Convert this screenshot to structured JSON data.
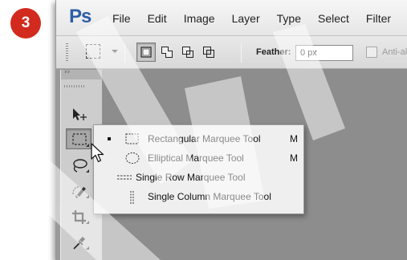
{
  "step_badge": "3",
  "app": {
    "logo": "Ps",
    "brand_color": "#2d5ea6",
    "menu": [
      "File",
      "Edit",
      "Image",
      "Layer",
      "Type",
      "Select",
      "Filter"
    ]
  },
  "options_bar": {
    "tool_preset_icon": "rectangular-marquee-icon",
    "selection_modes": [
      {
        "name": "new-selection",
        "active": true
      },
      {
        "name": "add-to-selection",
        "active": false
      },
      {
        "name": "subtract-from-selection",
        "active": false
      },
      {
        "name": "intersect-with-selection",
        "active": false
      }
    ],
    "feather_label": "Feather:",
    "feather_value": "0 px",
    "anti_alias_label": "Anti-alias",
    "anti_alias_checked": false
  },
  "toolbar": {
    "collapse_glyph": "››",
    "tools": [
      {
        "name": "move-tool",
        "icon": "move-arrow-icon",
        "active": false
      },
      {
        "name": "marquee-tool",
        "icon": "rectangular-marquee-icon",
        "active": true
      },
      {
        "name": "lasso-tool",
        "icon": "lasso-icon",
        "active": false
      },
      {
        "name": "quick-selection-tool",
        "icon": "quick-selection-brush-icon",
        "active": false
      },
      {
        "name": "crop-tool",
        "icon": "crop-icon",
        "active": false
      },
      {
        "name": "eyedropper-tool",
        "icon": "eyedropper-icon",
        "active": false
      }
    ]
  },
  "flyout": {
    "items": [
      {
        "label": "Rectangular Marquee Tool",
        "shortcut": "M",
        "selected": true,
        "icon": "rectangular-marquee-icon"
      },
      {
        "label": "Elliptical Marquee Tool",
        "shortcut": "M",
        "selected": false,
        "icon": "elliptical-marquee-icon"
      },
      {
        "label": "Single Row Marquee Tool",
        "shortcut": "",
        "selected": false,
        "icon": "single-row-marquee-icon"
      },
      {
        "label": "Single Column Marquee Tool",
        "shortcut": "",
        "selected": false,
        "icon": "single-column-marquee-icon"
      }
    ]
  },
  "colors": {
    "badge": "#d22a1f",
    "canvas": "#8d8d8d",
    "flyout_bg": "#efefef"
  }
}
